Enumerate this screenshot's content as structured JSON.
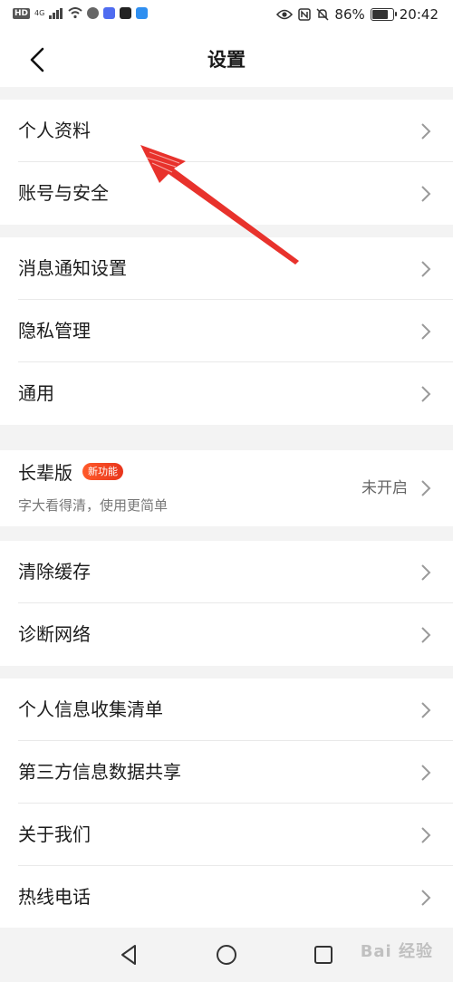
{
  "status_bar": {
    "net_tag": "HD",
    "net_gen": "4G",
    "battery_percent": "86%",
    "battery_level": 0.86,
    "time": "20:42"
  },
  "header": {
    "title": "设置"
  },
  "groups": [
    {
      "items": [
        {
          "label": "个人资料"
        },
        {
          "label": "账号与安全"
        }
      ]
    },
    {
      "items": [
        {
          "label": "消息通知设置"
        },
        {
          "label": "隐私管理"
        },
        {
          "label": "通用"
        }
      ]
    },
    {
      "elder": {
        "label": "长辈版",
        "badge": "新功能",
        "subtitle": "字大看得清，使用更简单",
        "status": "未开启"
      }
    },
    {
      "items": [
        {
          "label": "清除缓存"
        },
        {
          "label": "诊断网络"
        }
      ]
    },
    {
      "items": [
        {
          "label": "个人信息收集清单"
        },
        {
          "label": "第三方信息数据共享"
        },
        {
          "label": "关于我们"
        },
        {
          "label": "热线电话"
        }
      ]
    }
  ],
  "navbar": {
    "watermark": "Bai 经验"
  },
  "colors": {
    "accent_red": "#e8351c",
    "annotation_arrow": "#e8322c"
  }
}
